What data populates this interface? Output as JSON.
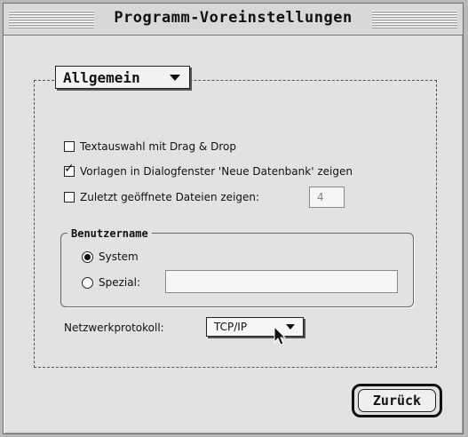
{
  "window": {
    "title": "Programm-Voreinstellungen"
  },
  "section_popup": {
    "label": "Allgemein"
  },
  "options": {
    "drag_drop": {
      "label": "Textauswahl mit Drag & Drop",
      "checked": false
    },
    "templates": {
      "label": "Vorlagen in Dialogfenster 'Neue Datenbank' zeigen",
      "checked": true
    },
    "recent_files": {
      "label": "Zuletzt geöffnete Dateien zeigen:",
      "checked": false,
      "count": "4"
    }
  },
  "username_group": {
    "title": "Benutzername",
    "system_label": "System",
    "special_label": "Spezial:",
    "selected": "System",
    "special_value": ""
  },
  "network": {
    "label": "Netzwerkprotokoll:",
    "selected": "TCP/IP"
  },
  "buttons": {
    "back_label": "Zurück"
  },
  "icons": {
    "checkmark": "✓"
  }
}
